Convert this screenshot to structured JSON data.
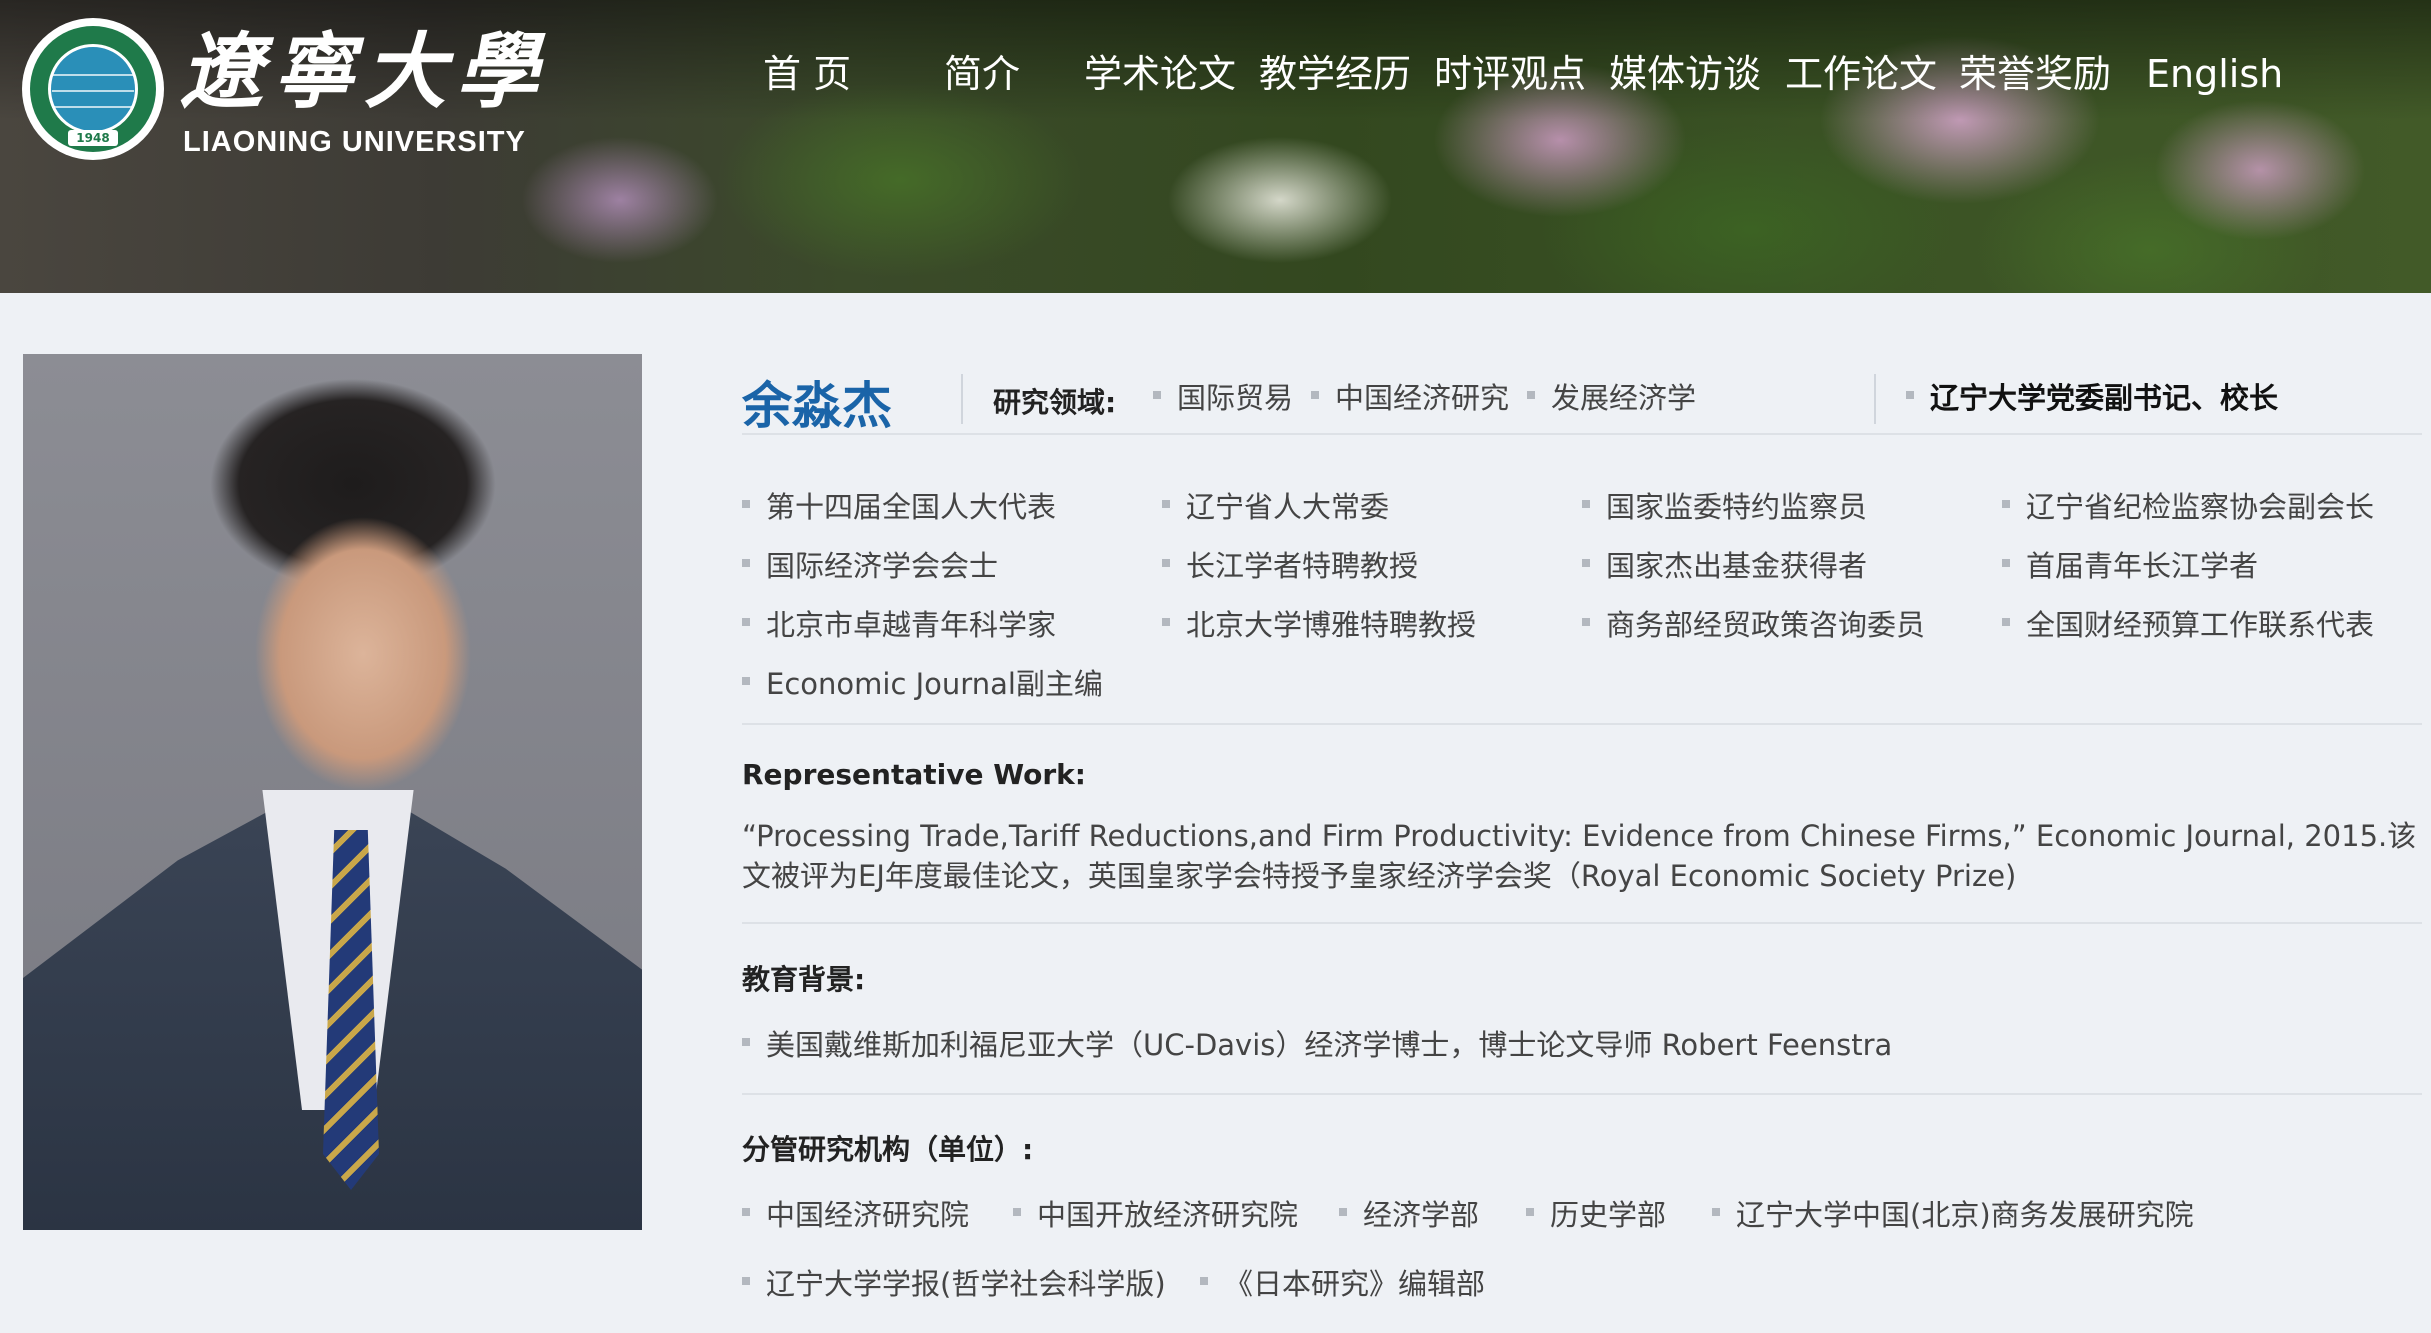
{
  "header": {
    "logo_cn": "遼寧大學",
    "logo_en": "LIAONING UNIVERSITY",
    "logo_year": "1948",
    "nav": [
      "首 页",
      "简介",
      "学术论文",
      "教学经历",
      "时评观点",
      "媒体访谈",
      "工作论文",
      "荣誉奖励",
      "English"
    ]
  },
  "profile": {
    "name": "余淼杰",
    "research_label": "研究领域:",
    "research_fields": [
      "国际贸易",
      "中国经济研究",
      "发展经济学"
    ],
    "position": "辽宁大学党委副书记、校长",
    "titles": [
      "第十四届全国人大代表",
      "辽宁省人大常委",
      "国家监委特约监察员",
      "辽宁省纪检监察协会副会长",
      "国际经济学会会士",
      "长江学者特聘教授",
      "国家杰出基金获得者",
      "首届青年长江学者",
      "北京市卓越青年科学家",
      "北京大学博雅特聘教授",
      "商务部经贸政策咨询委员",
      "全国财经预算工作联系代表",
      "Economic Journal副主编"
    ],
    "rep_work_label": "Representative Work:",
    "rep_work_text": "“Processing Trade,Tariff Reductions,and Firm Productivity: Evidence from Chinese Firms,”  Economic Journal, 2015.该文被评为EJ年度最佳论文，英国皇家学会特授予皇家经济学会奖（Royal Economic Society Prize)",
    "edu_label": "教育背景:",
    "edu_item": "美国戴维斯加利福尼亚大学（UC-Davis）经济学博士，博士论文导师 Robert Feenstra",
    "units_label": "分管研究机构（单位）:",
    "units": [
      "中国经济研究院",
      "中国开放经济研究院",
      "经济学部",
      "历史学部",
      "辽宁大学中国(北京)商务发展研究院",
      "辽宁大学学报(哲学社会科学版)",
      "《日本研究》编辑部"
    ]
  }
}
